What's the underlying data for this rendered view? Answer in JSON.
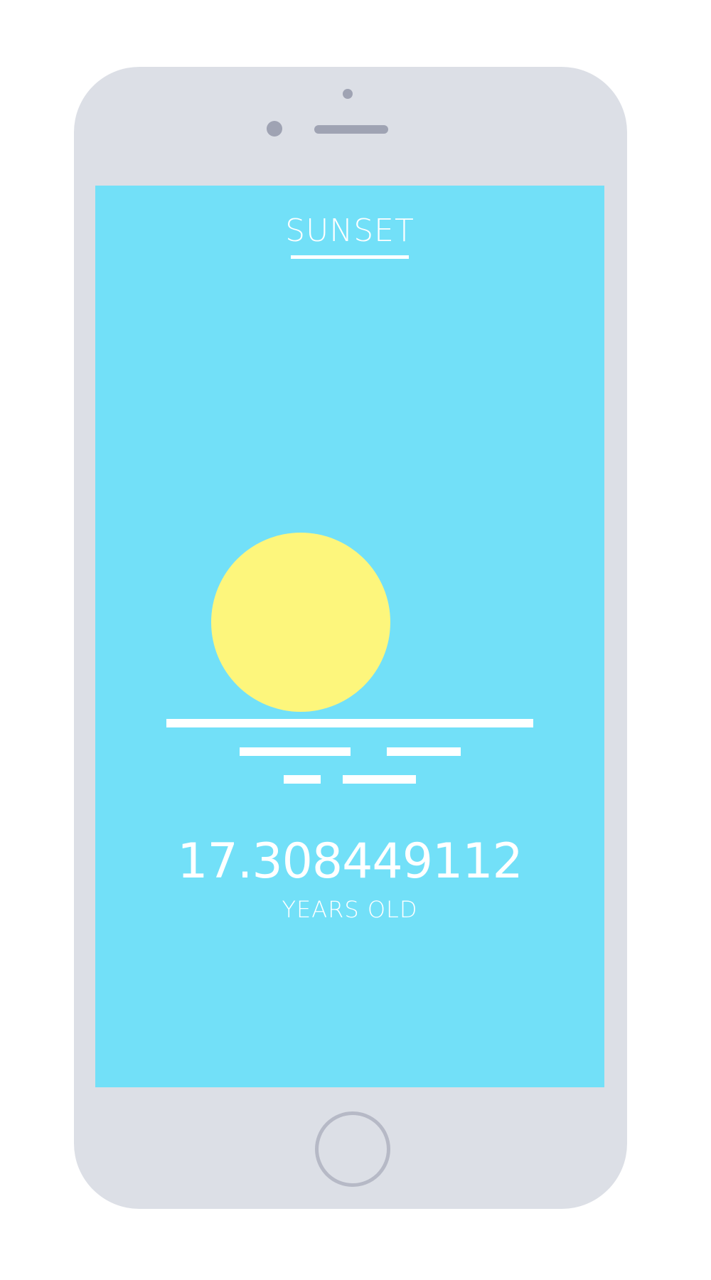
{
  "screen": {
    "title": "SUNSET",
    "age_value": "17.308449112",
    "age_label": "YEARS OLD"
  },
  "colors": {
    "sky": "#72e0f8",
    "sun": "#fdf67c",
    "lines": "#ffffff",
    "phone_body": "#dcdfe6",
    "phone_details": "#9fa3b3"
  },
  "icons": {
    "sun": "sun-icon",
    "water": "water-lines-icon"
  }
}
